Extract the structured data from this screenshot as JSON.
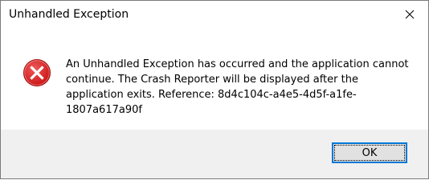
{
  "window": {
    "title": "Unhandled Exception"
  },
  "titlebar": {
    "close_icon": "close-icon"
  },
  "content": {
    "icon": "error-icon",
    "icon_color": "#e81123",
    "message": "An Unhandled Exception has occurred and the application cannot continue. The Crash Reporter will be displayed after the application exits. Reference: 8d4c104c-a4e5-4d5f-a1fe-1807a617a90f"
  },
  "footer": {
    "ok_label": "OK",
    "accent_color": "#0078d7"
  }
}
